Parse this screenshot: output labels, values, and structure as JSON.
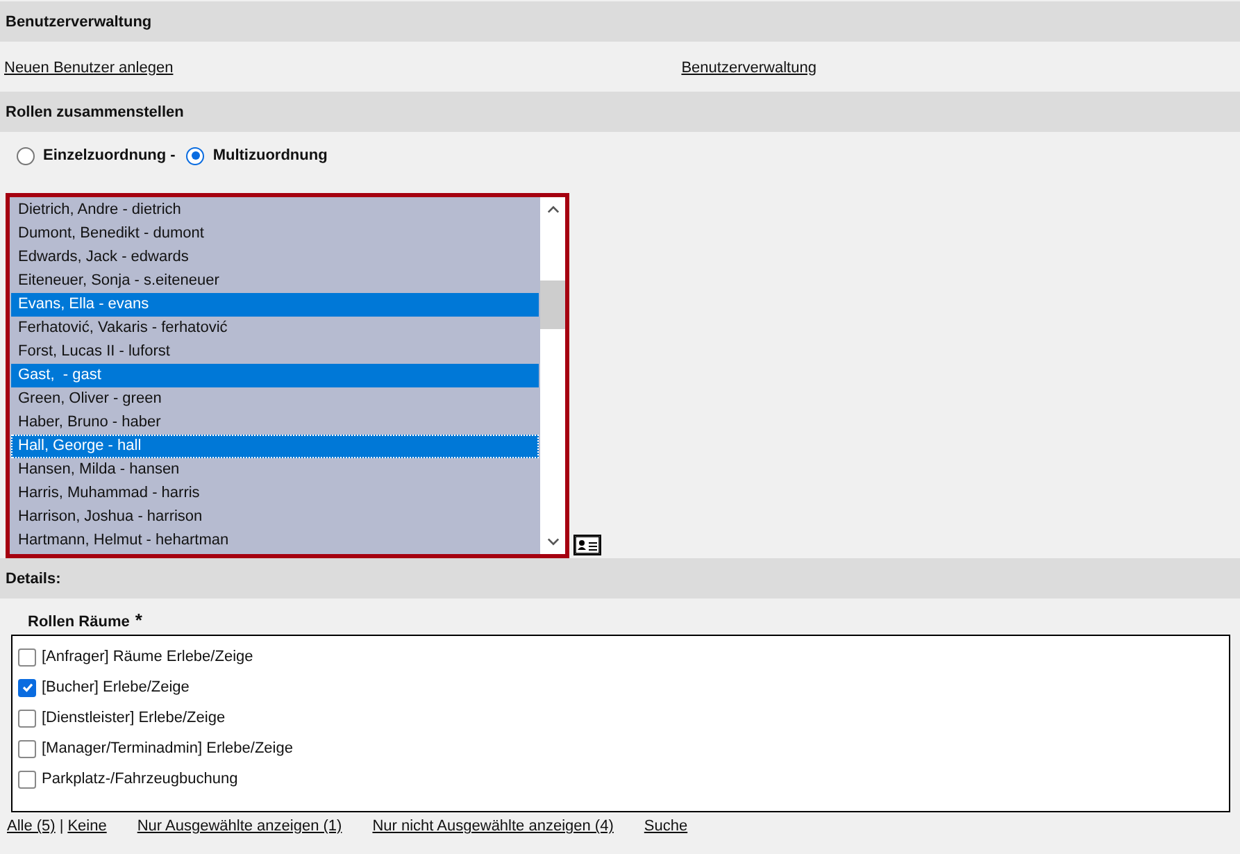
{
  "header": {
    "title": "Benutzerverwaltung"
  },
  "links": [
    "Neuen Benutzer anlegen",
    "Benutzerverwaltung"
  ],
  "roles_section": {
    "title": "Rollen zusammenstellen"
  },
  "mode": [
    {
      "label": "Einzelzuordnung -",
      "selected": false
    },
    {
      "label": "Multizuordnung",
      "selected": true
    }
  ],
  "users": [
    {
      "label": "Dietrich, Andre - dietrich",
      "selected": false,
      "focused": false
    },
    {
      "label": "Dumont, Benedikt - dumont",
      "selected": false,
      "focused": false
    },
    {
      "label": "Edwards, Jack - edwards",
      "selected": false,
      "focused": false
    },
    {
      "label": "Eiteneuer, Sonja - s.eiteneuer",
      "selected": false,
      "focused": false
    },
    {
      "label": "Evans, Ella - evans",
      "selected": true,
      "focused": false
    },
    {
      "label": "Ferhatović, Vakaris - ferhatović",
      "selected": false,
      "focused": false
    },
    {
      "label": "Forst, Lucas II - luforst",
      "selected": false,
      "focused": false
    },
    {
      "label": "Gast,  - gast",
      "selected": true,
      "focused": false
    },
    {
      "label": "Green, Oliver - green",
      "selected": false,
      "focused": false
    },
    {
      "label": "Haber, Bruno - haber",
      "selected": false,
      "focused": false
    },
    {
      "label": "Hall, George - hall",
      "selected": true,
      "focused": true
    },
    {
      "label": "Hansen, Milda - hansen",
      "selected": false,
      "focused": false
    },
    {
      "label": "Harris, Muhammad - harris",
      "selected": false,
      "focused": false
    },
    {
      "label": "Harrison, Joshua - harrison",
      "selected": false,
      "focused": false
    },
    {
      "label": "Hartmann, Helmut - hehartman",
      "selected": false,
      "focused": false
    }
  ],
  "details": {
    "title": "Details:"
  },
  "room_roles": {
    "label": "Rollen Räume",
    "required_mark": "*",
    "options": [
      {
        "label": "[Anfrager] Räume Erlebe/Zeige",
        "checked": false
      },
      {
        "label": "[Bucher] Erlebe/Zeige",
        "checked": true
      },
      {
        "label": "[Dienstleister] Erlebe/Zeige",
        "checked": false
      },
      {
        "label": "[Manager/Terminadmin] Erlebe/Zeige",
        "checked": false
      },
      {
        "label": "Parkplatz-/Fahrzeugbuchung",
        "checked": false
      }
    ]
  },
  "footer": {
    "all": "Alle (5)",
    "separator": "|",
    "none": "Keine",
    "selected_only": "Nur Ausgewählte anzeigen (1)",
    "unselected_only": "Nur nicht Ausgewählte anzeigen (4)",
    "search": "Suche"
  }
}
